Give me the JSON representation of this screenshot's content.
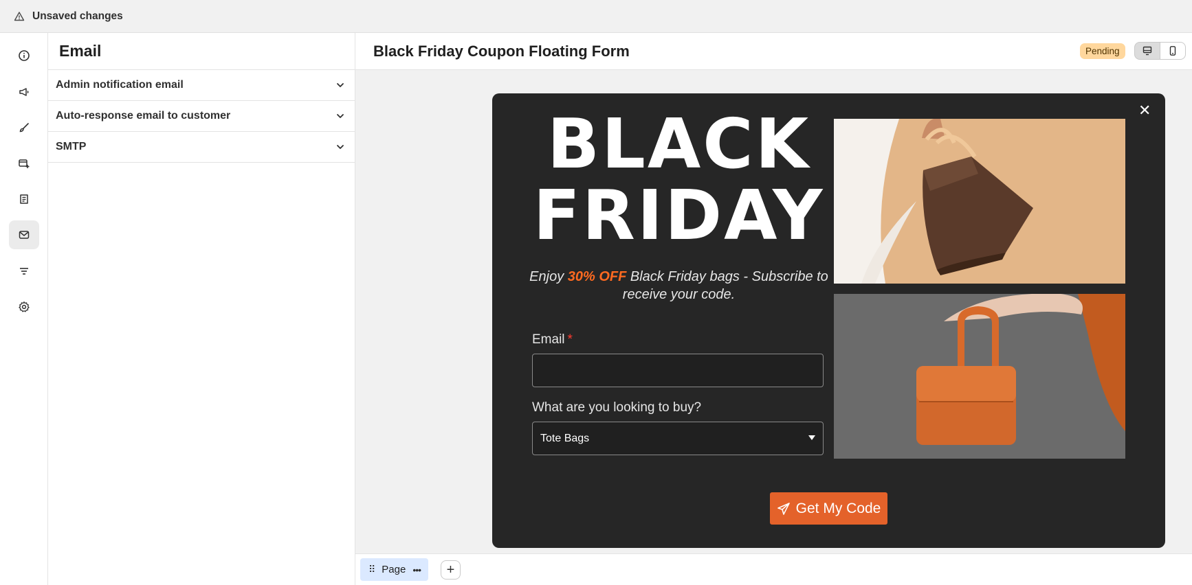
{
  "topbar": {
    "status": "Unsaved changes",
    "icon": "warning-icon"
  },
  "rail": {
    "items": [
      {
        "icon": "info-icon"
      },
      {
        "icon": "megaphone-icon"
      },
      {
        "icon": "brush-icon"
      },
      {
        "icon": "form-add-icon"
      },
      {
        "icon": "receipt-icon"
      },
      {
        "icon": "email-icon",
        "active": true
      },
      {
        "icon": "filter-icon"
      },
      {
        "icon": "settings-icon"
      }
    ]
  },
  "panel": {
    "title": "Email",
    "sections": [
      {
        "label": "Admin notification email"
      },
      {
        "label": "Auto-response email to customer"
      },
      {
        "label": "SMTP"
      }
    ]
  },
  "header": {
    "title": "Black Friday Coupon Floating Form",
    "status_badge": "Pending",
    "badge_color": "#ffd79d",
    "views": [
      "desktop-view-icon",
      "mobile-view-icon"
    ]
  },
  "popup": {
    "headline_line1": "BLACK",
    "headline_line2": "FRIDAY",
    "sub_pre": "Enjoy ",
    "sub_highlight": "30% OFF",
    "sub_post": " Black Friday bags - Subscribe to receive your code.",
    "highlight_color": "#ff6a20",
    "email_label": "Email",
    "email_required": "*",
    "email_value": "",
    "select_label": "What are you looking to buy?",
    "select_value": "Tote Bags",
    "cta_label": "Get My Code",
    "cta_color": "#e4622a",
    "close": "✕",
    "images": [
      "brown-tote-bag-photo",
      "orange-handbag-photo"
    ]
  },
  "footer": {
    "page_tab": "Page",
    "add": "+"
  }
}
